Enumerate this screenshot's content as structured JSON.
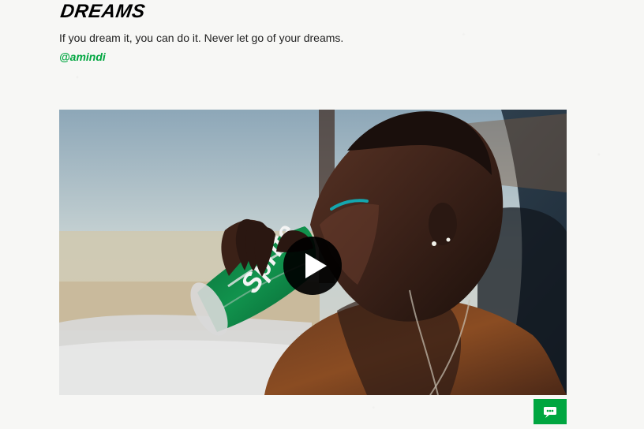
{
  "post": {
    "title": "DREAMS",
    "text": "If you dream it, you can do it. Never let go of your dreams.",
    "handle": "@amindi"
  },
  "video": {
    "can_label": "Sprite",
    "play_icon": "play-icon"
  },
  "chat": {
    "icon": "chat-icon"
  },
  "colors": {
    "accent_green": "#00a640",
    "title_black": "#000000",
    "background": "#f7f7f5"
  }
}
